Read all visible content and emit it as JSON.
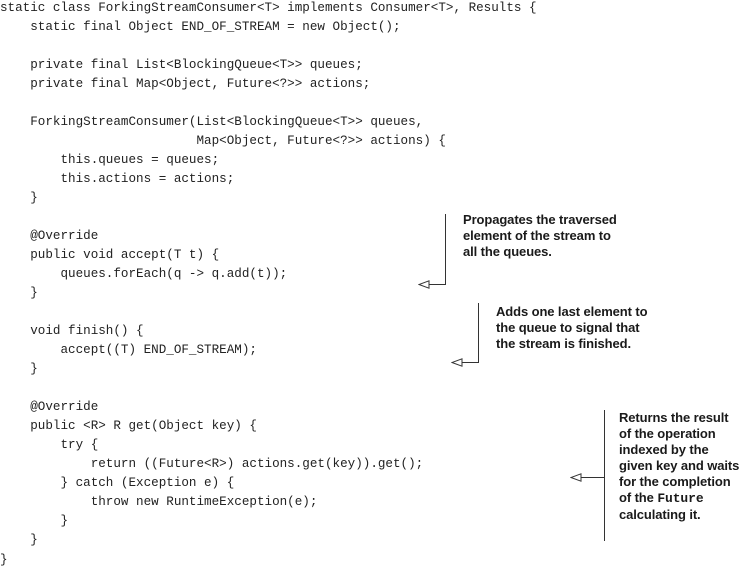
{
  "code_lines": [
    "static class ForkingStreamConsumer<T> implements Consumer<T>, Results {",
    "    static final Object END_OF_STREAM = new Object();",
    "",
    "    private final List<BlockingQueue<T>> queues;",
    "    private final Map<Object, Future<?>> actions;",
    "",
    "    ForkingStreamConsumer(List<BlockingQueue<T>> queues,",
    "                          Map<Object, Future<?>> actions) {",
    "        this.queues = queues;",
    "        this.actions = actions;",
    "    }",
    "",
    "    @Override",
    "    public void accept(T t) {",
    "        queues.forEach(q -> q.add(t));",
    "    }",
    "",
    "    void finish() {",
    "        accept((T) END_OF_STREAM);",
    "    }",
    "",
    "    @Override",
    "    public <R> R get(Object key) {",
    "        try {",
    "            return ((Future<R>) actions.get(key)).get();",
    "        } catch (Exception e) {",
    "            throw new RuntimeException(e);",
    "        }",
    "    }",
    "}"
  ],
  "annotations": {
    "accept": {
      "lines": [
        "Propagates the traversed",
        "element of the stream to",
        "all the queues."
      ]
    },
    "finish": {
      "lines": [
        "Adds one last element to",
        "the queue to signal that",
        "the stream is finished."
      ]
    },
    "get": {
      "lines": [
        "Returns the result",
        "of the operation",
        "indexed by the",
        "given key and waits",
        "for the completion",
        "of the",
        "calculating it."
      ],
      "code_term": "Future"
    }
  },
  "colors": {
    "code_text": "#222222",
    "annotation_text": "#1a1a1a",
    "callout_line": "#333333"
  }
}
